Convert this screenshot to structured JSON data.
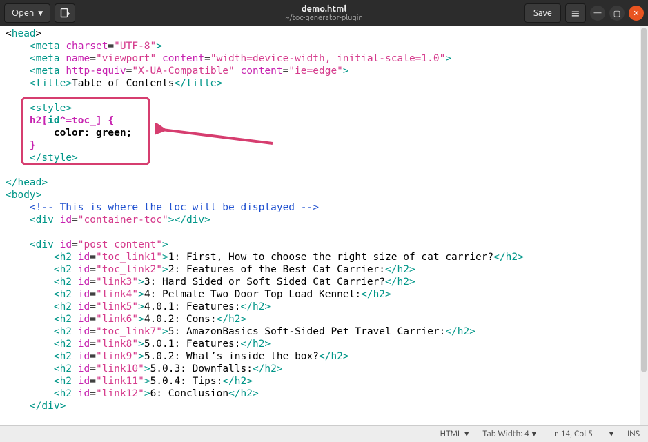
{
  "titlebar": {
    "open_label": "Open",
    "file_name": "demo.html",
    "file_path": "~/toc-generator-plugin",
    "save_label": "Save"
  },
  "code": {
    "l1_tag": "head",
    "l2_tag": "meta",
    "l2_attr": "charset",
    "l2_val": "\"UTF-8\"",
    "l3_tag": "meta",
    "l3_attr1": "name",
    "l3_val1": "\"viewport\"",
    "l3_attr2": "content",
    "l3_val2": "\"width=device-width, initial-scale=1.0\"",
    "l4_tag": "meta",
    "l4_attr1": "http-equiv",
    "l4_val1": "\"X-UA-Compatible\"",
    "l4_attr2": "content",
    "l4_val2": "\"ie=edge\"",
    "l5_open": "title",
    "l5_text": "Table of Contents",
    "l5_close": "title",
    "l7_tag": "style",
    "l8_sel_a": "h2",
    "l8_sel_b": "id",
    "l8_sel_c": "^=toc_",
    "l9_prop": "color",
    "l9_val": "green",
    "l11_tag": "style",
    "l13_tag": "head",
    "l14_tag": "body",
    "l15_cmt": "<!-- This is where the toc will be displayed -->",
    "l16_tag": "div",
    "l16_attr": "id",
    "l16_val": "\"container-toc\"",
    "l18_tag": "div",
    "l18_attr": "id",
    "l18_val": "\"post_content\"",
    "h2": [
      {
        "id": "\"toc_link1\"",
        "text": "1: First, How to choose the right size of cat carrier?"
      },
      {
        "id": "\"toc_link2\"",
        "text": "2: Features of the Best Cat Carrier:"
      },
      {
        "id": "\"link3\"",
        "text": "3: Hard Sided or Soft Sided Cat Carrier?"
      },
      {
        "id": "\"link4\"",
        "text": "4: Petmate Two Door Top Load Kennel:"
      },
      {
        "id": "\"link5\"",
        "text": "4.0.1: Features:"
      },
      {
        "id": "\"link6\"",
        "text": "4.0.2: Cons:"
      },
      {
        "id": "\"toc_link7\"",
        "text": "5: AmazonBasics Soft-Sided Pet Travel Carrier:"
      },
      {
        "id": "\"link8\"",
        "text": "5.0.1: Features:"
      },
      {
        "id": "\"link9\"",
        "text": "5.0.2: What’s inside the box?"
      },
      {
        "id": "\"link10\"",
        "text": "5.0.3: Downfalls:"
      },
      {
        "id": "\"link11\"",
        "text": "5.0.4: Tips:"
      },
      {
        "id": "\"link12\"",
        "text": "6: Conclusion"
      }
    ],
    "l31_tag": "div",
    "h2tag": "h2",
    "h2attr": "id"
  },
  "statusbar": {
    "lang": "HTML",
    "tab": "Tab Width: 4",
    "pos": "Ln 14, Col 5",
    "ins": "INS"
  }
}
